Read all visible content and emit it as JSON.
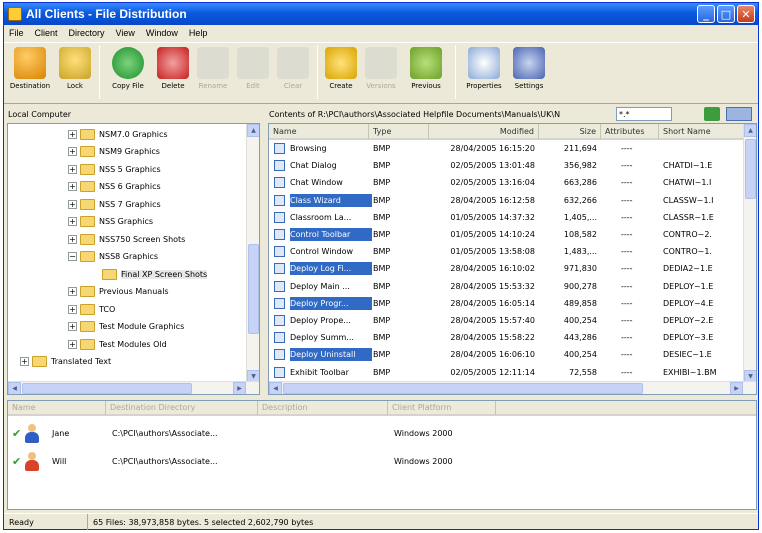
{
  "window": {
    "title": "All Clients - File Distribution"
  },
  "menu": [
    "File",
    "Client",
    "Directory",
    "View",
    "Window",
    "Help"
  ],
  "toolbar": [
    {
      "label": "Destination",
      "icon": "destination-icon",
      "enabled": true
    },
    {
      "label": "Lock",
      "icon": "lock-icon",
      "enabled": true
    },
    {
      "label": "Copy File",
      "icon": "copy-file-icon",
      "enabled": true
    },
    {
      "label": "Delete",
      "icon": "delete-icon",
      "enabled": true
    },
    {
      "label": "Rename",
      "icon": "rename-icon",
      "enabled": false
    },
    {
      "label": "Edit",
      "icon": "edit-icon",
      "enabled": false
    },
    {
      "label": "Clear",
      "icon": "clear-icon",
      "enabled": false
    },
    {
      "label": "Create",
      "icon": "create-icon",
      "enabled": true
    },
    {
      "label": "Versions",
      "icon": "versions-icon",
      "enabled": false
    },
    {
      "label": "Previous",
      "icon": "previous-icon",
      "enabled": true
    },
    {
      "label": "Properties",
      "icon": "properties-icon",
      "enabled": true
    },
    {
      "label": "Settings",
      "icon": "settings-icon",
      "enabled": true
    }
  ],
  "left_panel": {
    "title": "Local Computer",
    "tree": [
      {
        "label": "NSM7.0 Graphics",
        "level": 2,
        "expander": "+"
      },
      {
        "label": "NSM9 Graphics",
        "level": 2,
        "expander": "+"
      },
      {
        "label": "NSS 5 Graphics",
        "level": 2,
        "expander": "+"
      },
      {
        "label": "NSS 6 Graphics",
        "level": 2,
        "expander": "+"
      },
      {
        "label": "NSS 7 Graphics",
        "level": 2,
        "expander": "+"
      },
      {
        "label": "NSS Graphics",
        "level": 2,
        "expander": "+"
      },
      {
        "label": "NSS750 Screen Shots",
        "level": 2,
        "expander": "+"
      },
      {
        "label": "NSS8 Graphics",
        "level": 2,
        "expander": "−"
      },
      {
        "label": "Final XP Screen Shots",
        "level": 3,
        "expander": "",
        "selected": true
      },
      {
        "label": "Previous Manuals",
        "level": 2,
        "expander": "+"
      },
      {
        "label": "TCO",
        "level": 2,
        "expander": "+"
      },
      {
        "label": "Test Module Graphics",
        "level": 2,
        "expander": "+"
      },
      {
        "label": "Test Modules Old",
        "level": 2,
        "expander": "+"
      },
      {
        "label": "Translated Text",
        "level": 1,
        "expander": "+"
      }
    ]
  },
  "right_panel": {
    "path_label": "Contents of R:\\PCI\\authors\\Associated Helpfile Documents\\Manuals\\UK\\N",
    "filter_value": "*.*",
    "columns": [
      "Name",
      "Type",
      "Modified",
      "Size",
      "Attributes",
      "Short Name"
    ],
    "files": [
      {
        "name": "Browsing",
        "type": "BMP",
        "modified": "28/04/2005 16:15:20",
        "size": "211,694",
        "attributes": "----",
        "short": "",
        "selected": false
      },
      {
        "name": "Chat Dialog",
        "type": "BMP",
        "modified": "02/05/2005 13:01:48",
        "size": "356,982",
        "attributes": "----",
        "short": "CHATDI~1.E",
        "selected": false
      },
      {
        "name": "Chat Window",
        "type": "BMP",
        "modified": "02/05/2005 13:16:04",
        "size": "663,286",
        "attributes": "----",
        "short": "CHATWI~1.I",
        "selected": false
      },
      {
        "name": "Class Wizard",
        "type": "BMP",
        "modified": "28/04/2005 16:12:58",
        "size": "632,266",
        "attributes": "----",
        "short": "CLASSW~1.I",
        "selected": true
      },
      {
        "name": "Classroom La...",
        "type": "BMP",
        "modified": "01/05/2005 14:37:32",
        "size": "1,405,...",
        "attributes": "----",
        "short": "CLASSR~1.E",
        "selected": false
      },
      {
        "name": "Control Toolbar",
        "type": "BMP",
        "modified": "01/05/2005 14:10:24",
        "size": "108,582",
        "attributes": "----",
        "short": "CONTRO~2.",
        "selected": true
      },
      {
        "name": "Control Window",
        "type": "BMP",
        "modified": "01/05/2005 13:58:08",
        "size": "1,483,...",
        "attributes": "----",
        "short": "CONTRO~1.",
        "selected": false
      },
      {
        "name": "Deploy Log Fi...",
        "type": "BMP",
        "modified": "28/04/2005 16:10:02",
        "size": "971,830",
        "attributes": "----",
        "short": "DEDIA2~1.E",
        "selected": true
      },
      {
        "name": "Deploy Main ...",
        "type": "BMP",
        "modified": "28/04/2005 15:53:32",
        "size": "900,278",
        "attributes": "----",
        "short": "DEPLOY~1.E",
        "selected": false
      },
      {
        "name": "Deploy Progr...",
        "type": "BMP",
        "modified": "28/04/2005 16:05:14",
        "size": "489,858",
        "attributes": "----",
        "short": "DEPLOY~4.E",
        "selected": true
      },
      {
        "name": "Deploy Prope...",
        "type": "BMP",
        "modified": "28/04/2005 15:57:40",
        "size": "400,254",
        "attributes": "----",
        "short": "DEPLOY~2.E",
        "selected": false
      },
      {
        "name": "Deploy Summ...",
        "type": "BMP",
        "modified": "28/04/2005 15:58:22",
        "size": "443,286",
        "attributes": "----",
        "short": "DEPLOY~3.E",
        "selected": false
      },
      {
        "name": "Deploy Uninstall",
        "type": "BMP",
        "modified": "28/04/2005 16:06:10",
        "size": "400,254",
        "attributes": "----",
        "short": "DESIEC~1.E",
        "selected": true
      },
      {
        "name": "Exhibit Toolbar",
        "type": "BMP",
        "modified": "02/05/2005 12:11:14",
        "size": "72,558",
        "attributes": "----",
        "short": "EXHIBI~1.BM",
        "selected": false
      }
    ]
  },
  "destinations": {
    "columns": [
      "Name",
      "Destination Directory",
      "Description",
      "Client Platform"
    ],
    "rows": [
      {
        "name": "Jane",
        "dir": "C:\\PCI\\authors\\Associate...",
        "desc": "",
        "platform": "Windows 2000",
        "avatar_color": "#2f5fc4"
      },
      {
        "name": "Will",
        "dir": "C:\\PCI\\authors\\Associate...",
        "desc": "",
        "platform": "Windows 2000",
        "avatar_color": "#d9432a"
      }
    ]
  },
  "status": {
    "left": "Ready",
    "right": "65 Files: 38,973,858 bytes. 5 selected 2,602,790 bytes"
  }
}
